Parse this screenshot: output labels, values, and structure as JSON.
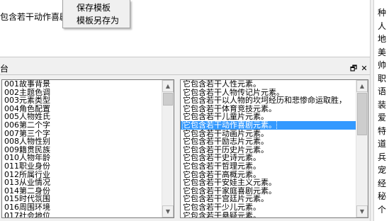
{
  "top_text": "包含若干动作喜剧",
  "context_menu": {
    "items": [
      "保存模板",
      "模板另存为"
    ]
  },
  "right_column": {
    "items": [
      "种",
      "人",
      "地",
      "美",
      "帅",
      "职",
      "语",
      "装",
      "爱",
      "特",
      "道",
      "兵",
      "宠",
      "经",
      "秘",
      "个"
    ]
  },
  "panel": {
    "title": "台",
    "restore_glyph": "🗗",
    "close_glyph": "✕"
  },
  "left_list": {
    "items": [
      "001故事背景",
      "002主题色调",
      "003元素类型",
      "004角色配置",
      "005人物姓氏",
      "006第二个字",
      "007第三个字",
      "008人物性别",
      "009籍贯民族",
      "010人物年龄",
      "011职业身份",
      "012所属行业",
      "013从业情况",
      "014第二身份",
      "015时代氛围",
      "016周围环境",
      "017社会地位"
    ]
  },
  "right_list": {
    "items": [
      "它包含若干人性元素。",
      "它包含若干人物传记片元素。",
      "它包含若干以人物的坎坷经历和悲惨命运取胜，",
      "它包含若干体育竞技元素。",
      "它包含若干儿童片元素。",
      "它包含若干动作喜剧元素。",
      "它包含若干动画片元素。",
      "它包含若干励志片元素。",
      "它包含若干历史片元素。",
      "它包含若干史诗元素。",
      "它包含若干哲理元素。",
      "它包含若干高概元素。",
      "它包含若干安娃主义元素。",
      "它包含若干家庭喜剧元素。",
      "它包含若干宫廷片元素。",
      "它包含若干少儿元素。",
      "它包含若干悬疑元素。"
    ],
    "selected_index": 5
  },
  "scrollbar": {
    "up_glyph": "▲",
    "down_glyph": "▼"
  }
}
